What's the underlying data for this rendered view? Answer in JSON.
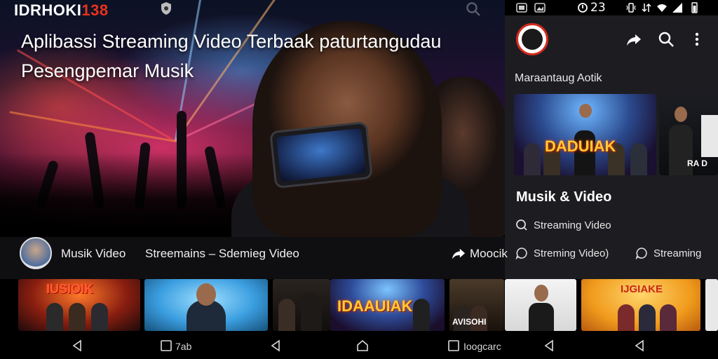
{
  "hero": {
    "brand_main": "IDRHOKI",
    "brand_number": "138",
    "title_line1": "Aplibassi Streaming Video Terbaak  paturtangudau",
    "title_line2": "Pesengpemar Musik"
  },
  "status_bar": {
    "time": "23"
  },
  "panel": {
    "subtitle": "Maraantaug Aotik",
    "thumb_main_label": "DADUIAK",
    "thumb_side_label": "RA D",
    "section_title": "Musik & Video",
    "chip_streaming_video": "Streaming Video",
    "chip_streaming_video_paren": "Streming Video)",
    "chip_streaming": "Streaming"
  },
  "strip": {
    "musik_video": "Musik Video",
    "streamains": "Streemains  –  Sdemieg Video",
    "moocik": "Moocik"
  },
  "bottom_thumbs": {
    "thumb1_label": "IUSIOIK",
    "thumb4_label": "IDAAUIAK",
    "thumb5_label": "AVISOHI",
    "thumb7_label": "IJGIAKE"
  },
  "navbar": {
    "label_left": "7ab",
    "label_right": "Ioogcarc"
  },
  "colors": {
    "brand_red": "#e8321e",
    "panel_bg": "#1d1d21",
    "accent_yellow": "#ffcc33"
  }
}
